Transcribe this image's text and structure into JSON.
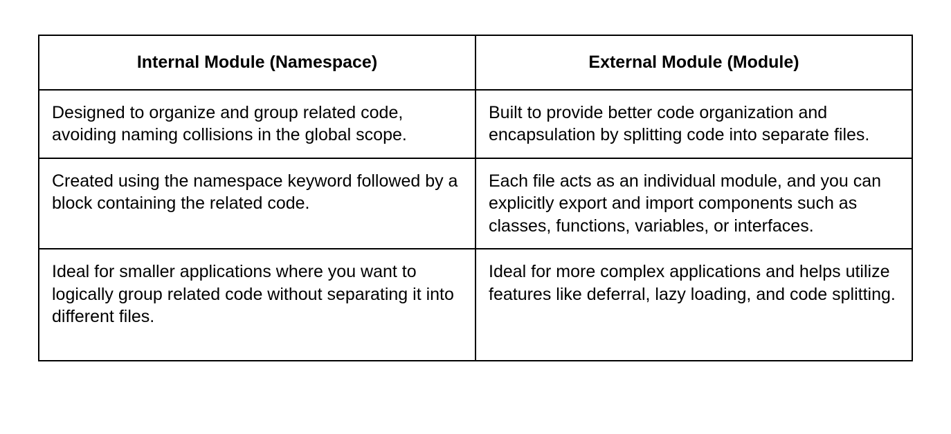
{
  "table": {
    "headers": {
      "col1": "Internal Module (Namespace)",
      "col2": "External Module (Module)"
    },
    "rows": [
      {
        "col1": "Designed to organize and group related code, avoiding naming collisions in the global scope.",
        "col2": "Built to provide better code organization and encapsulation by splitting code into separate files."
      },
      {
        "col1": "Created using the namespace keyword followed by a block containing the related code.",
        "col2": "Each file acts as an individual module, and you can explicitly export and import components such as classes, functions, variables, or interfaces."
      },
      {
        "col1": "Ideal for smaller applications where you want to logically group related code without separating it into different files.",
        "col2": "Ideal for more complex applications and helps utilize features like deferral, lazy loading, and code splitting."
      }
    ]
  }
}
